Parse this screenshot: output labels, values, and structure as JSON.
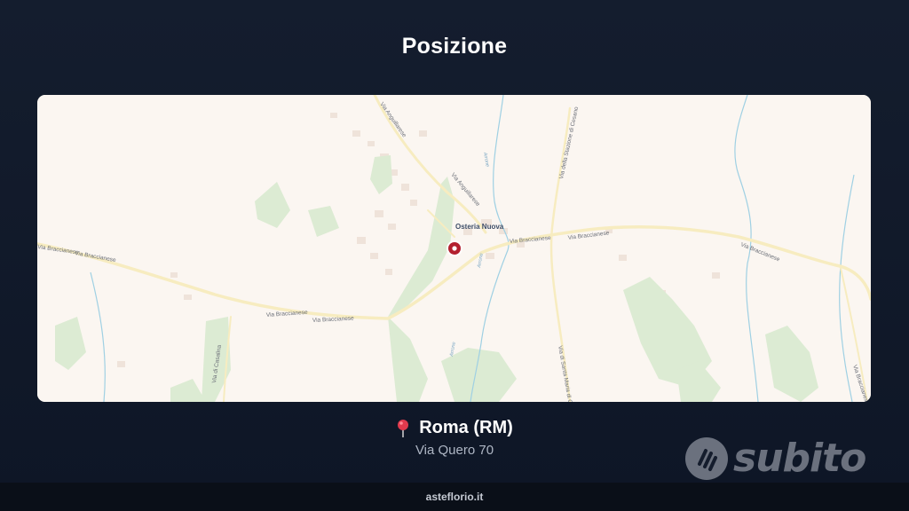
{
  "header": {
    "title": "Posizione"
  },
  "map": {
    "place_label": "Osteria Nuova",
    "roads": {
      "via_braccianese": "Via Braccianese",
      "via_anguillarese": "Via Anguillarese",
      "via_della_stazione": "Via della Stazione di Cesano",
      "via_di_santa_maria": "Via di Santa Maria di Galeria",
      "via_di_casalina": "Via di Casalina"
    },
    "river_label": "Arrone",
    "marker_icon": "location-marker",
    "colors": {
      "land": "#fbf6f1",
      "park": "#dcebd3",
      "water": "#9fd0e3",
      "road": "#fbf0c9",
      "marker": "#b3202f"
    }
  },
  "location": {
    "pin_icon": "red-pushpin",
    "city": "Roma (RM)",
    "address": "Via Quero 70"
  },
  "branding": {
    "logo_text": "subito"
  },
  "footer": {
    "site": "asteflorio.it"
  }
}
